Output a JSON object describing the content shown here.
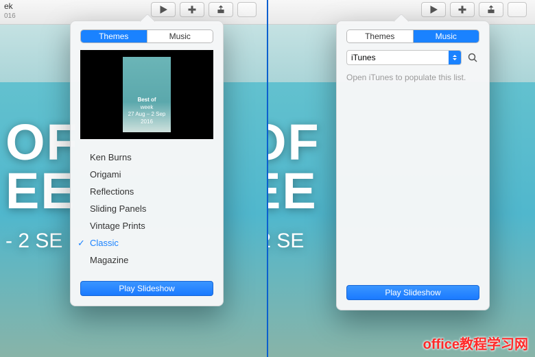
{
  "header": {
    "title": "ek",
    "subtitle": "016"
  },
  "bg_title": {
    "line1": "OF",
    "line2": "EE",
    "date_prefix": "- 2 SE"
  },
  "toolbar": {
    "play": "play-icon",
    "add": "add-icon",
    "share": "share-icon"
  },
  "left_popover": {
    "tabs": {
      "themes": "Themes",
      "music": "Music",
      "active": "themes"
    },
    "preview": {
      "title": "Best of",
      "subtitle": "week",
      "dates": "27 Aug – 2 Sep 2016"
    },
    "themes": [
      {
        "label": "Ken Burns",
        "selected": false
      },
      {
        "label": "Origami",
        "selected": false
      },
      {
        "label": "Reflections",
        "selected": false
      },
      {
        "label": "Sliding Panels",
        "selected": false
      },
      {
        "label": "Vintage Prints",
        "selected": false
      },
      {
        "label": "Classic",
        "selected": true
      },
      {
        "label": "Magazine",
        "selected": false
      }
    ],
    "play_button": "Play Slideshow"
  },
  "right_popover": {
    "tabs": {
      "themes": "Themes",
      "music": "Music",
      "active": "music"
    },
    "source_select": "iTunes",
    "hint": "Open iTunes to populate this list.",
    "play_button": "Play Slideshow"
  },
  "watermarks": {
    "cn": "office教程学习网",
    "ghost": ""
  }
}
